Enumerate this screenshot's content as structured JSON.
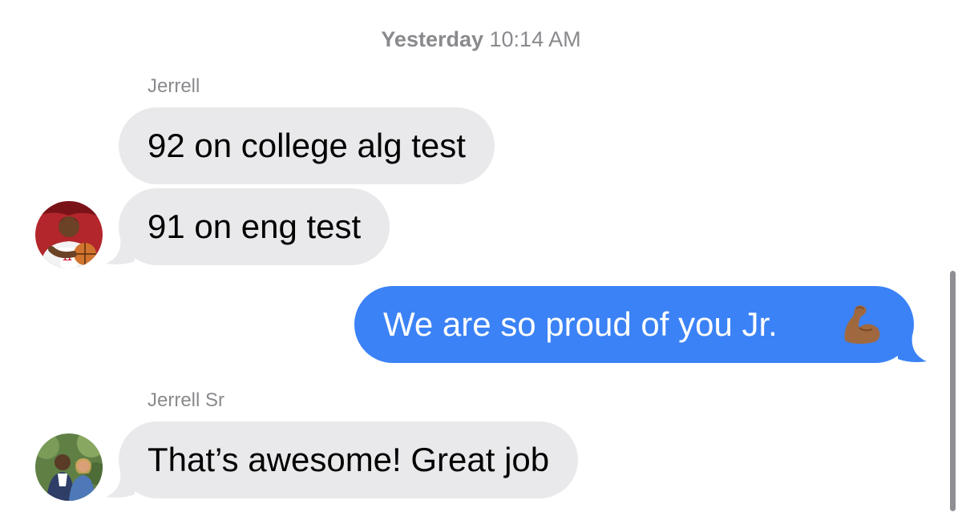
{
  "timestamp": {
    "day": "Yesterday",
    "time": "10:14 AM"
  },
  "messages": [
    {
      "sender": "Jerrell",
      "text": "92 on college alg test",
      "direction": "incoming"
    },
    {
      "sender": "Jerrell",
      "text": "91 on eng test",
      "direction": "incoming"
    },
    {
      "sender": "me",
      "text": "We are so proud of you Jr.",
      "emoji": "flexed-biceps-medium-dark-skin",
      "direction": "outgoing"
    },
    {
      "sender": "Jerrell Sr",
      "text": "That’s awesome! Great job",
      "direction": "incoming"
    }
  ],
  "senders": {
    "jerrell": "Jerrell",
    "jerrell_sr": "Jerrell Sr"
  },
  "colors": {
    "incoming_bubble": "#e9e9eb",
    "outgoing_bubble": "#3b82f6",
    "meta_text": "#8a8a8e"
  }
}
